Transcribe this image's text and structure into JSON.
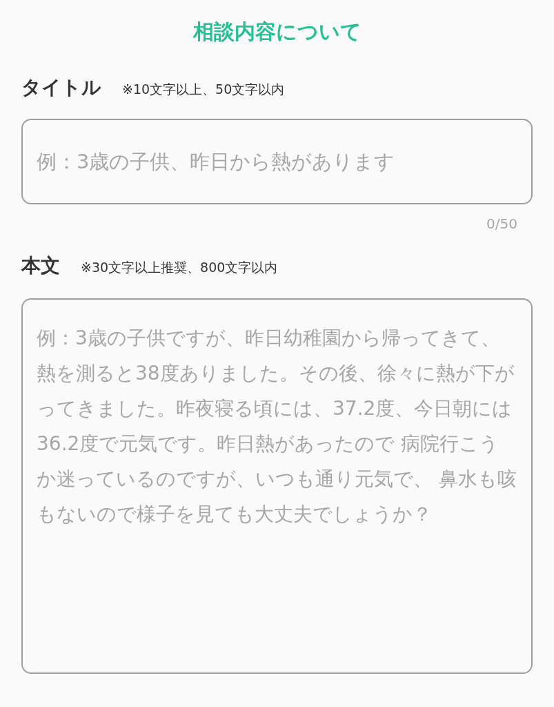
{
  "heading": "相談内容について",
  "title_field": {
    "label": "タイトル",
    "hint": "※10文字以上、50文字以内",
    "placeholder": "例：3歳の子供、昨日から熱があります",
    "counter": "0/50"
  },
  "body_field": {
    "label": "本文",
    "hint": "※30文字以上推奨、800文字以内",
    "placeholder": "例：3歳の子供ですが、昨日幼稚園から帰ってきて、熱を測ると38度ありました。その後、徐々に熱が下がってきました。昨夜寝る頃には、37.2度、今日朝には36.2度で元気です。昨日熱があったので 病院行こうか迷っているのですが、いつも通り元気で、 鼻水も咳もないので様子を見ても大丈夫でしょうか？"
  }
}
